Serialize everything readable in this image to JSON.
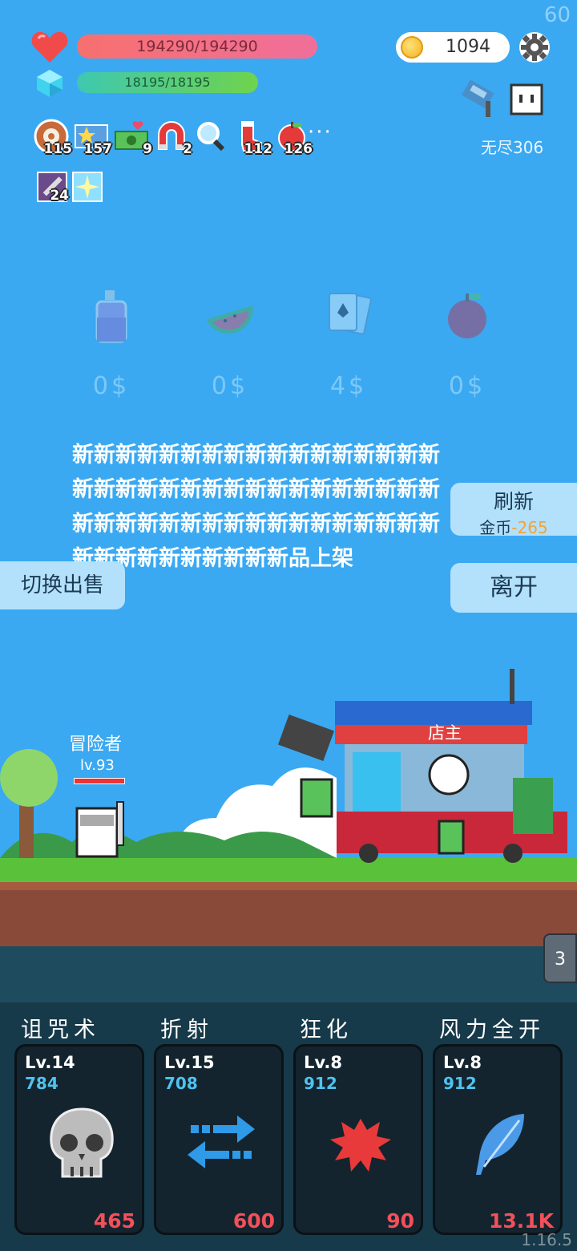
{
  "fps": "60",
  "version": "1.16.5",
  "hud": {
    "hp": "194290/194290",
    "mp": "18195/18195",
    "coins": "1094",
    "mode": "无尽306"
  },
  "buffs": [
    {
      "icon": "target-icon",
      "count": "115"
    },
    {
      "icon": "star-card-icon",
      "count": "157"
    },
    {
      "icon": "cash-heart-icon",
      "count": "9"
    },
    {
      "icon": "magnet-icon",
      "count": "2"
    },
    {
      "icon": "magnifier-icon",
      "count": ""
    },
    {
      "icon": "sock-icon",
      "count": "112"
    },
    {
      "icon": "apple-icon",
      "count": "126"
    }
  ],
  "buffs_more": "···",
  "buffs_row2": [
    {
      "icon": "sword-icon",
      "count": "24"
    },
    {
      "icon": "sparkle-icon",
      "count": ""
    }
  ],
  "shop_items": [
    {
      "icon": "bottle-icon",
      "price": "0$"
    },
    {
      "icon": "watermelon-icon",
      "price": "0$"
    },
    {
      "icon": "cards-icon",
      "price": "4$"
    },
    {
      "icon": "apple-icon",
      "price": "0$"
    }
  ],
  "notice": "新新新新新新新新新新新新新新新新新新新新新新新新新新新新新新新新新新新新新新新新新新新新新新新新新新新新新新新新新新新新新品上架",
  "buttons": {
    "refresh": "刷新",
    "refresh_cost_label": "金币",
    "refresh_cost": "-265",
    "switch": "切换出售",
    "leave": "离开"
  },
  "scene": {
    "adventurer_name": "冒险者",
    "adventurer_level": "lv.93",
    "shopkeeper": "店主"
  },
  "page_tab": "3",
  "skills": [
    {
      "name": "诅咒术",
      "level": "Lv.14",
      "value": "784",
      "cost": "465",
      "icon": "skull-icon"
    },
    {
      "name": "折射",
      "level": "Lv.15",
      "value": "708",
      "cost": "600",
      "icon": "arrows-icon"
    },
    {
      "name": "狂化",
      "level": "Lv.8",
      "value": "912",
      "cost": "90",
      "icon": "splash-icon"
    },
    {
      "name": "风力全开",
      "level": "Lv.8",
      "value": "912",
      "cost": "13.1K",
      "icon": "feather-icon"
    }
  ],
  "colors": {
    "sky": "#3aa9f2",
    "hp": "#f06f9a",
    "mp": "#6fd34c",
    "cost_red": "#f2505a",
    "skill_blue": "#4fc3f0"
  }
}
